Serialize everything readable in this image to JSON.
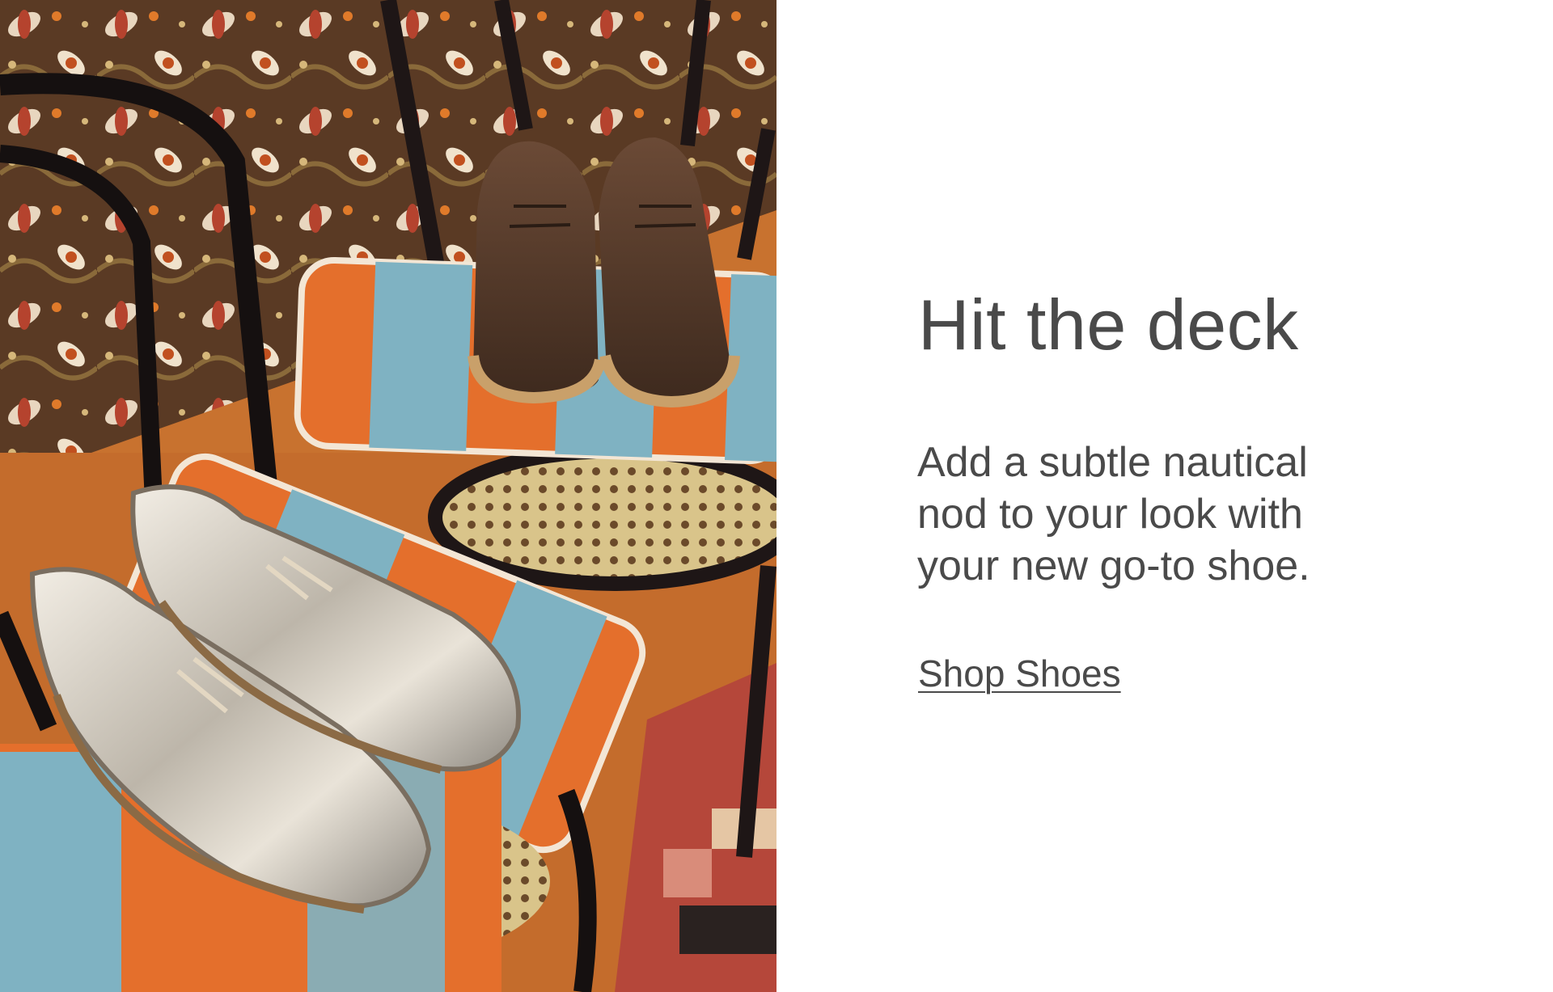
{
  "promo": {
    "image_alt": "Brown suede and metallic silver boat shoes displayed on striped orange and blue velvet cushions on black bentwood chairs",
    "headline": "Hit the deck",
    "body": "Add a subtle nautical nod to your look with your new go-to shoe.",
    "cta_label": "Shop Shoes"
  },
  "colors": {
    "text": "#4a4a4a",
    "background": "#ffffff"
  }
}
